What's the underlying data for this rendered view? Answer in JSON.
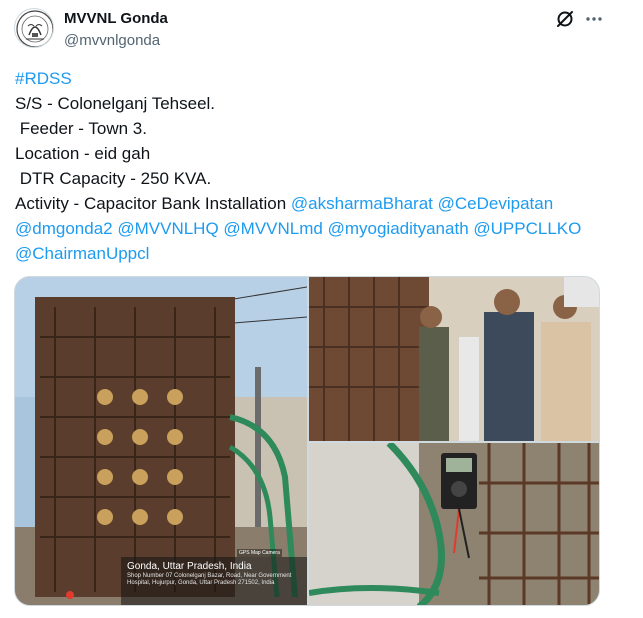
{
  "author": {
    "name": "MVVNL Gonda",
    "handle": "@mvvnlgonda"
  },
  "tweet": {
    "hashtag": "#RDSS",
    "lines": [
      "S/S - Colonelganj Tehseel.",
      " Feeder - Town 3.",
      "Location - eid gah",
      " DTR Capacity - 250 KVA."
    ],
    "activity_prefix": "Activity - Capacitor Bank Installation ",
    "mentions": [
      "@aksharmaBharat",
      "@CeDevipatan",
      "@dmgonda2",
      "@MVVNLHQ",
      "@MVVNLmd",
      "@myogiadityanath",
      "@UPPCLLKO",
      "@ChairmanUppcl"
    ]
  },
  "photo1_overlay": {
    "tag": "GPS Map Camera",
    "title": "Gonda, Uttar Pradesh, India",
    "address": "Shop Number 07 Colonelganj Bazar, Road, Near Government Hospital, Hujurpur, Gonda, Uttar Pradesh 271502, India"
  },
  "icons": {
    "avatar": "state-emblem-icon",
    "grok": "grok-icon",
    "more": "more-dots-icon"
  },
  "colors": {
    "link": "#1d9bf0",
    "text": "#0f1419",
    "secondary": "#536471"
  }
}
